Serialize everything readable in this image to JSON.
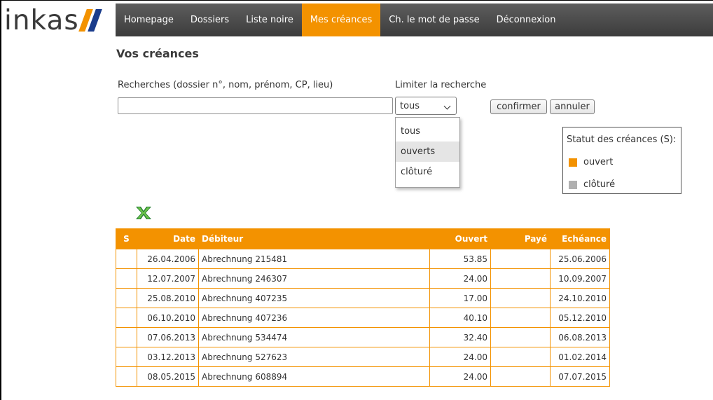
{
  "logo": {
    "text": "inkas",
    "mark_colors": [
      "#f39200",
      "#1a3c8c"
    ]
  },
  "nav": {
    "items": [
      {
        "label": "Homepage",
        "active": false
      },
      {
        "label": "Dossiers",
        "active": false
      },
      {
        "label": "Liste noire",
        "active": false
      },
      {
        "label": "Mes créances",
        "active": true
      },
      {
        "label": "Ch. le mot de passe",
        "active": false
      },
      {
        "label": "Déconnexion",
        "active": false
      }
    ],
    "accent_color": "#f39200"
  },
  "page": {
    "title": "Vos créances"
  },
  "search": {
    "label": "Recherches (dossier n°, nom, prénom, CP, lieu)",
    "value": "",
    "placeholder": ""
  },
  "limit": {
    "label": "Limiter la recherche",
    "selected": "tous",
    "options": [
      "tous",
      "ouverts",
      "clôturé"
    ],
    "hovered": "ouverts"
  },
  "buttons": {
    "confirm": "confirmer",
    "cancel": "annuler"
  },
  "legend": {
    "title": "Statut des créances (S):",
    "items": [
      {
        "label": "ouvert",
        "color": "#f39200"
      },
      {
        "label": "clôturé",
        "color": "#b0b0b0"
      }
    ]
  },
  "export_icon": "excel-icon",
  "table": {
    "headers": {
      "status": "S",
      "date": "Date",
      "debtor": "Débiteur",
      "open": "Ouvert",
      "paid": "Payé",
      "due": "Echéance"
    },
    "rows": [
      {
        "status": "",
        "date": "26.04.2006",
        "debtor": "Abrechnung 215481",
        "open": "53.85",
        "paid": "",
        "due": "25.06.2006"
      },
      {
        "status": "",
        "date": "12.07.2007",
        "debtor": "Abrechnung 246307",
        "open": "24.00",
        "paid": "",
        "due": "10.09.2007"
      },
      {
        "status": "",
        "date": "25.08.2010",
        "debtor": "Abrechnung 407235",
        "open": "17.00",
        "paid": "",
        "due": "24.10.2010"
      },
      {
        "status": "",
        "date": "06.10.2010",
        "debtor": "Abrechnung 407236",
        "open": "40.10",
        "paid": "",
        "due": "05.12.2010"
      },
      {
        "status": "",
        "date": "07.06.2013",
        "debtor": "Abrechnung 534474",
        "open": "32.40",
        "paid": "",
        "due": "06.08.2013"
      },
      {
        "status": "",
        "date": "03.12.2013",
        "debtor": "Abrechnung 527623",
        "open": "24.00",
        "paid": "",
        "due": "01.02.2014"
      },
      {
        "status": "",
        "date": "08.05.2015",
        "debtor": "Abrechnung 608894",
        "open": "24.00",
        "paid": "",
        "due": "07.07.2015"
      }
    ]
  }
}
